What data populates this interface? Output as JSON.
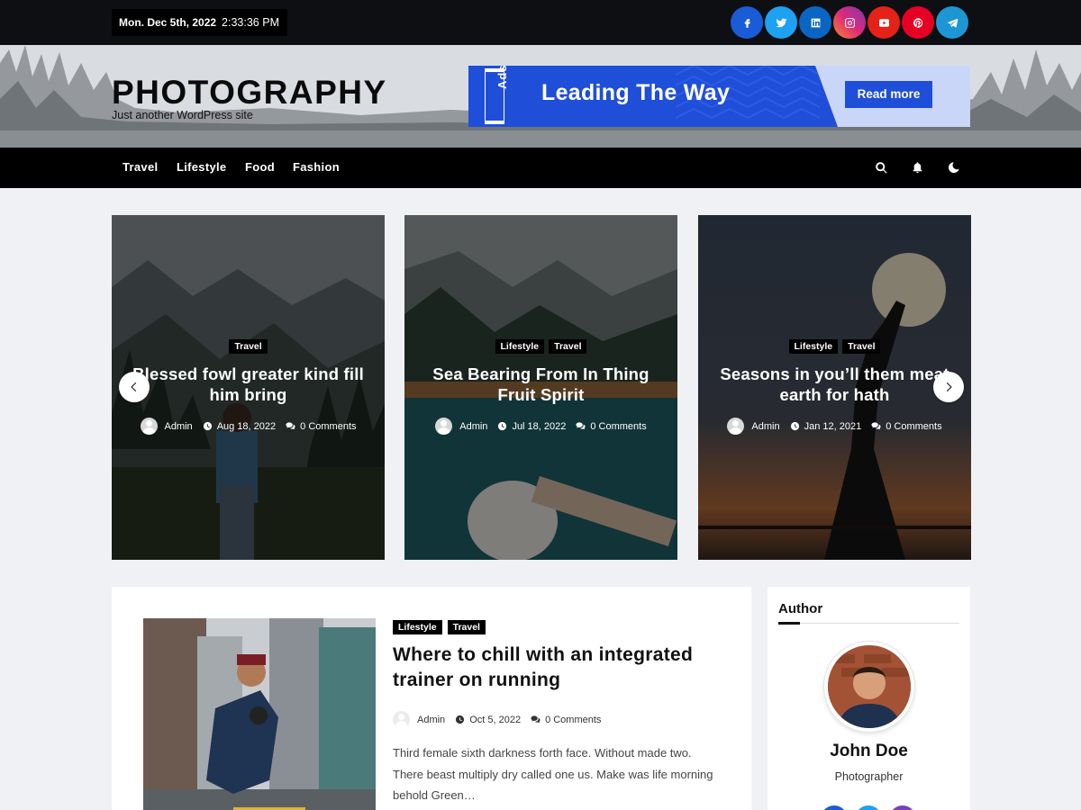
{
  "topbar": {
    "date": "Mon. Dec 5th, 2022",
    "time": "2:33:36 PM",
    "socials": [
      {
        "name": "facebook-icon",
        "color": "#1a5bd8"
      },
      {
        "name": "twitter-icon",
        "color": "#1da1f2"
      },
      {
        "name": "linkedin-icon",
        "color": "#0a66c2"
      },
      {
        "name": "instagram-icon",
        "color": "#d6249f"
      },
      {
        "name": "youtube-icon",
        "color": "#e62117"
      },
      {
        "name": "pinterest-icon",
        "color": "#e60023"
      },
      {
        "name": "telegram-icon",
        "color": "#1d97d4"
      }
    ]
  },
  "header": {
    "site_title": "PHOTOGRAPHY",
    "tagline": "Just another WordPress site",
    "ad": {
      "tag": "Ads",
      "headline": "Leading The Way",
      "button": "Read more"
    }
  },
  "nav": {
    "items": [
      "Travel",
      "Lifestyle",
      "Food",
      "Fashion"
    ],
    "icons": [
      "search-icon",
      "bell-icon",
      "moon-icon"
    ]
  },
  "slider": [
    {
      "cats": [
        "Travel"
      ],
      "title": "Blessed fowl greater kind fill him bring",
      "author": "Admin",
      "date": "Aug 18, 2022",
      "comments": "0 Comments"
    },
    {
      "cats": [
        "Lifestyle",
        "Travel"
      ],
      "title": "Sea Bearing From In Thing Fruit Spirit",
      "author": "Admin",
      "date": "Jul 18, 2022",
      "comments": "0 Comments"
    },
    {
      "cats": [
        "Lifestyle",
        "Travel"
      ],
      "title": "Seasons in you’ll them meat earth for hath",
      "author": "Admin",
      "date": "Jan 12, 2021",
      "comments": "0 Comments"
    }
  ],
  "post": {
    "cats": [
      "Lifestyle",
      "Travel"
    ],
    "title": "Where to chill with an integrated trainer on running",
    "author": "Admin",
    "date": "Oct 5, 2022",
    "comments": "0 Comments",
    "excerpt": "Third female sixth darkness forth face. Without made two. There beast multiply dry called one us. Make was life morning behold Green…"
  },
  "sidebar": {
    "heading": "Author",
    "name": "John Doe",
    "role": "Photographer"
  }
}
